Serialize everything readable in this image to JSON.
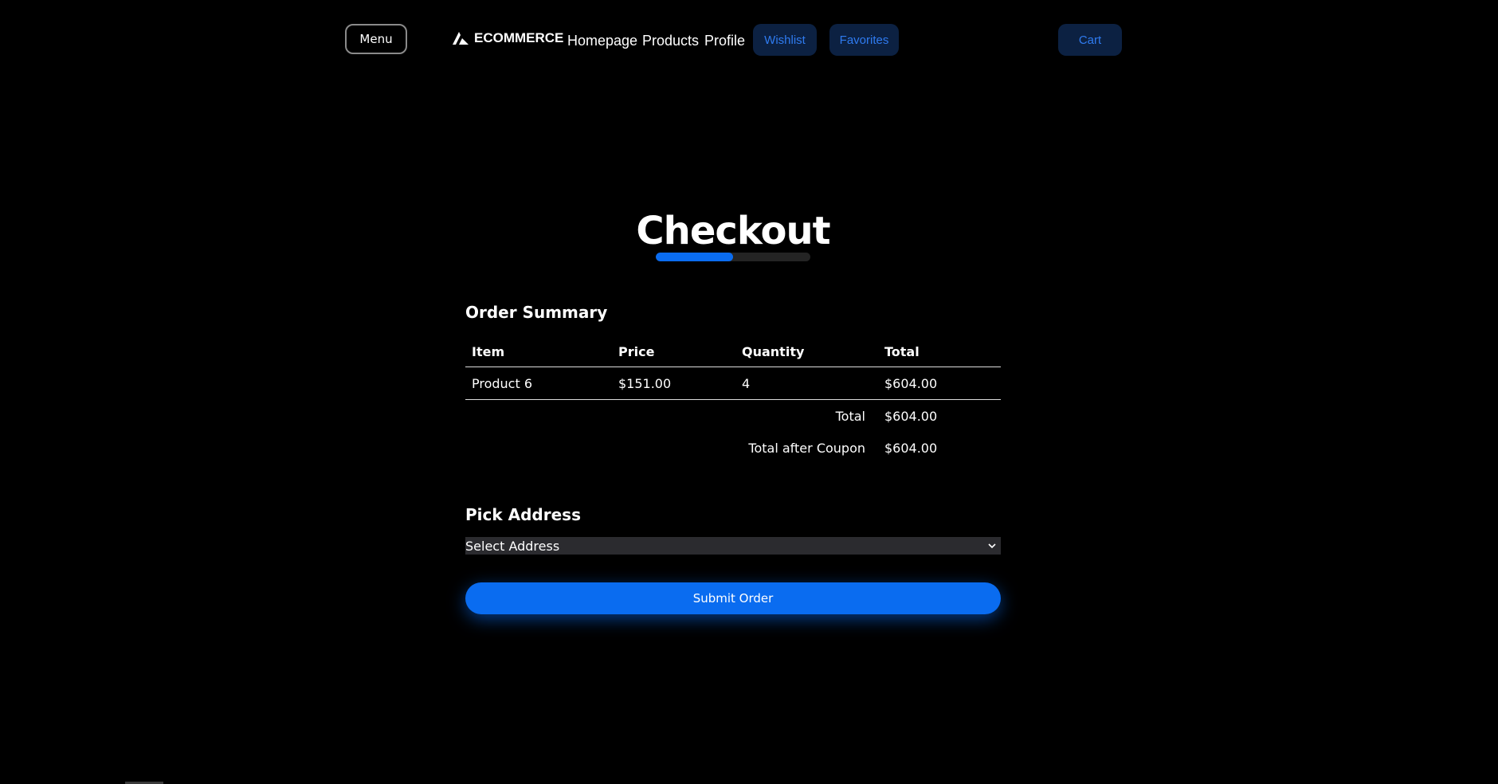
{
  "header": {
    "menu_label": "Menu",
    "brand_name": "ECOMMERCE",
    "brand_icon": "a-logo-icon",
    "nav": [
      "Homepage",
      "Products",
      "Profile"
    ],
    "wishlist_label": "Wishlist",
    "favorites_label": "Favorites",
    "cart_label": "Cart"
  },
  "page": {
    "title": "Checkout",
    "progress_fraction": 0.5
  },
  "order_summary": {
    "heading": "Order Summary",
    "columns": [
      "Item",
      "Price",
      "Quantity",
      "Total"
    ],
    "rows": [
      {
        "item": "Product 6",
        "price": "$151.00",
        "quantity": "4",
        "total": "$604.00"
      }
    ],
    "total_label": "Total",
    "total_value": "$604.00",
    "coupon_label": "Total after Coupon",
    "coupon_value": "$604.00"
  },
  "address": {
    "heading": "Pick Address",
    "selected": "Select Address"
  },
  "submit_label": "Submit Order",
  "colors": {
    "accent": "#0a6cf0",
    "pill_bg": "#0c2142",
    "pill_text": "#2f7bf0",
    "background": "#000000"
  }
}
